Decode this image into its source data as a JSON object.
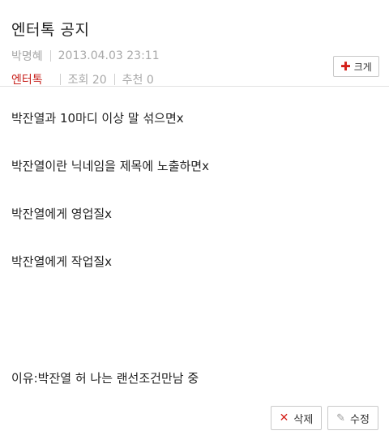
{
  "post": {
    "title": "엔터톡 공지",
    "author": "박명혜",
    "datetime": "2013.04.03  23:11",
    "category": "엔터톡",
    "views": "조회 20",
    "recommend": "추천 0",
    "big_label": "크게"
  },
  "body_lines": [
    "박잔열과 10마디 이상 말 섞으면x",
    "박잔열이란 닉네임을 제목에 노출하면x",
    "박잔열에게 영업질x",
    "박잔열에게 작업질x"
  ],
  "reason": "이유:박잔열 허 나는 랜선조건만남 중",
  "buttons": {
    "delete": "삭제",
    "edit": "수정"
  }
}
